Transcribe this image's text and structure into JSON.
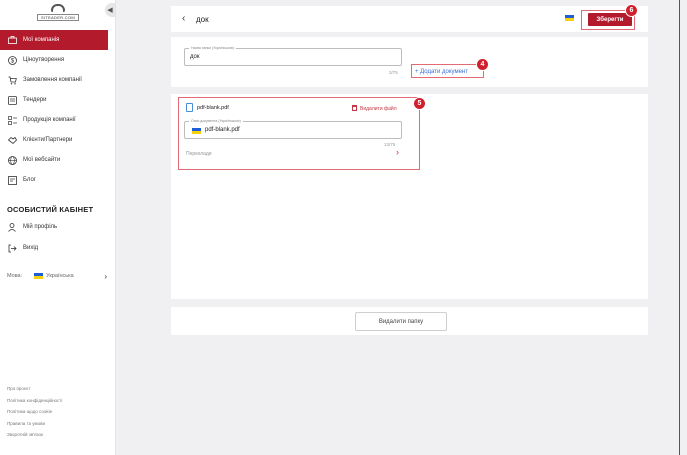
{
  "logo": {
    "text": "SITEADER.COM"
  },
  "sidebar": {
    "items": [
      {
        "label": "Мої компанія",
        "icon": "briefcase-icon",
        "active": true
      },
      {
        "label": "Ціноутворення",
        "icon": "dollar-icon",
        "active": false
      },
      {
        "label": "Замовлення компанії",
        "icon": "cart-icon",
        "active": false
      },
      {
        "label": "Тендери",
        "icon": "tender-icon",
        "active": false
      },
      {
        "label": "Продукція компанії",
        "icon": "list-icon",
        "active": false
      },
      {
        "label": "Клієнти/Партнери",
        "icon": "handshake-icon",
        "active": false
      },
      {
        "label": "Мої вебсайти",
        "icon": "globe-icon",
        "active": false
      },
      {
        "label": "Блог",
        "icon": "blog-icon",
        "active": false
      }
    ],
    "cabinet_title": "ОСОБИСТИЙ КАБІНЕТ",
    "profile_label": "Мій профіль",
    "logout_label": "Вихід",
    "language_label": "Мова:",
    "language_value": "Українська",
    "footer_links": [
      "Про проєкт",
      "Політика конфіденційності",
      "Політика щодо cookie",
      "Правила та умови",
      "Зворотній зв'язок"
    ]
  },
  "header": {
    "title": "док",
    "save_label": "Зберегти",
    "badge_save": "6"
  },
  "folder": {
    "name_label": "Назва папки (Українською)",
    "name_value": "док",
    "counter": "3/75",
    "add_doc_label": "+ Додати документ",
    "badge_add": "4"
  },
  "document": {
    "file_name": "pdf-blank.pdf",
    "delete_label": "Видалити файл",
    "desc_label": "Опис документа (Українською)",
    "desc_value": "pdf-blank.pdf",
    "counter": "13/75",
    "translations_label": "Переклади",
    "badge_doc": "5"
  },
  "delete_folder_label": "Видалити папку",
  "colors": {
    "accent": "#b31b2d",
    "link": "#3a6fd8",
    "badge": "#d0202e"
  }
}
